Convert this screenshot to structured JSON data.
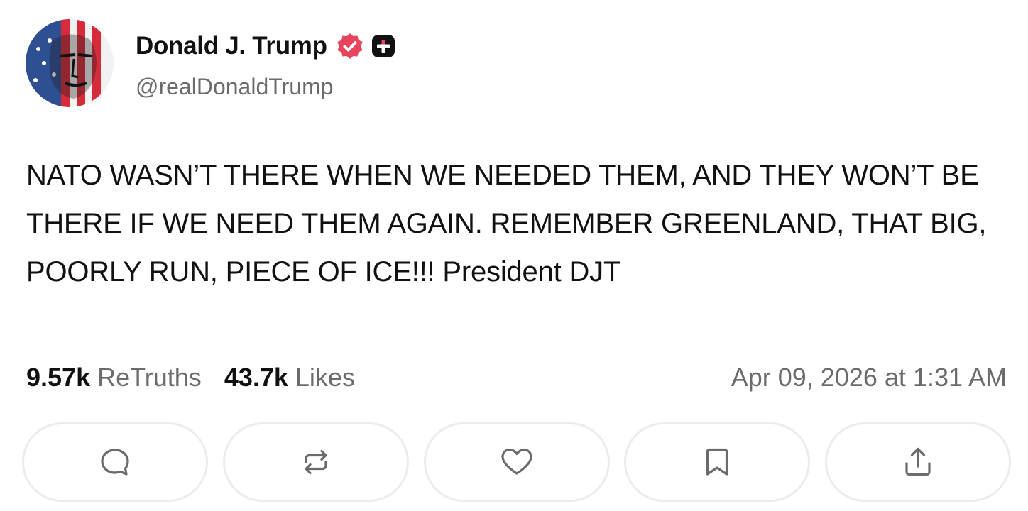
{
  "profile": {
    "display_name": "Donald J. Trump",
    "handle": "@realDonaldTrump",
    "verified_icon": "verified-badge-icon",
    "plus_icon": "plus-badge-icon",
    "badge_color": "#E8455C"
  },
  "post": {
    "text": "NATO WASN’T THERE WHEN WE NEEDED THEM, AND THEY WON’T BE THERE IF WE NEED THEM AGAIN. REMEMBER GREENLAND, THAT BIG, POORLY RUN, PIECE OF ICE!!! President DJT"
  },
  "stats": {
    "retruths_count": "9.57k",
    "retruths_label": "ReTruths",
    "likes_count": "43.7k",
    "likes_label": "Likes",
    "timestamp": "Apr 09, 2026 at 1:31 AM"
  },
  "actions": [
    {
      "name": "reply",
      "icon": "comment-icon"
    },
    {
      "name": "retruth",
      "icon": "repost-icon"
    },
    {
      "name": "like",
      "icon": "heart-icon"
    },
    {
      "name": "bookmark",
      "icon": "bookmark-icon"
    },
    {
      "name": "share",
      "icon": "share-icon"
    }
  ]
}
